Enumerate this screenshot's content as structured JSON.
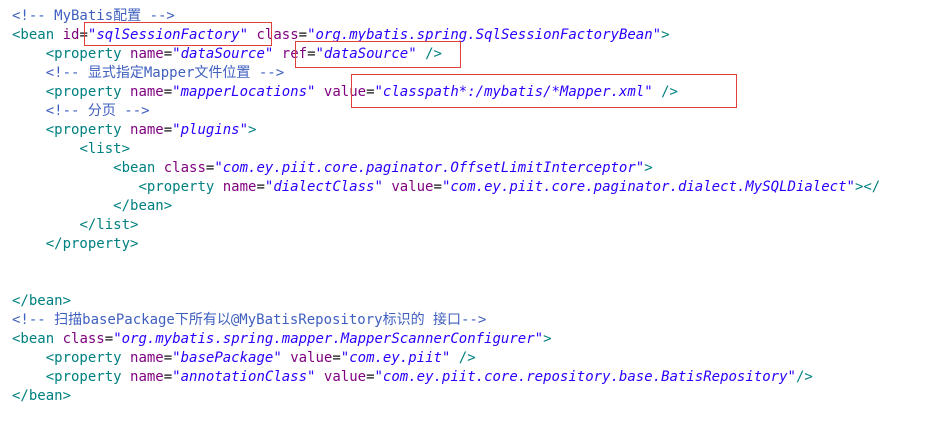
{
  "editor": {
    "highlight_color": "#e0403a",
    "lines": [
      {
        "tokens": [
          {
            "t": "comment",
            "v": "<!-- MyBatis配置 -->"
          }
        ]
      },
      {
        "tokens": [
          {
            "t": "tag",
            "v": "<bean"
          },
          {
            "t": "space",
            "v": " "
          },
          {
            "t": "attr",
            "v": "id"
          },
          {
            "t": "eq",
            "v": "="
          },
          {
            "t": "val",
            "v": "\"sqlSessionFactory\""
          },
          {
            "t": "space",
            "v": " "
          },
          {
            "t": "attr",
            "v": "class"
          },
          {
            "t": "eq",
            "v": "="
          },
          {
            "t": "val",
            "v": "\"org.mybatis.spring.SqlSessionFactoryBean\""
          },
          {
            "t": "punct",
            "v": ">"
          }
        ]
      },
      {
        "tokens": [
          {
            "t": "space",
            "v": "    "
          },
          {
            "t": "tag",
            "v": "<property"
          },
          {
            "t": "space",
            "v": " "
          },
          {
            "t": "attr",
            "v": "name"
          },
          {
            "t": "eq",
            "v": "="
          },
          {
            "t": "val",
            "v": "\"dataSource\""
          },
          {
            "t": "space",
            "v": " "
          },
          {
            "t": "attr",
            "v": "ref"
          },
          {
            "t": "eq",
            "v": "="
          },
          {
            "t": "val",
            "v": "\"dataSource\""
          },
          {
            "t": "space",
            "v": " "
          },
          {
            "t": "punct",
            "v": "/>"
          }
        ]
      },
      {
        "tokens": [
          {
            "t": "space",
            "v": "    "
          },
          {
            "t": "comment",
            "v": "<!-- 显式指定Mapper文件位置 -->"
          }
        ]
      },
      {
        "tokens": [
          {
            "t": "space",
            "v": "    "
          },
          {
            "t": "tag",
            "v": "<property"
          },
          {
            "t": "space",
            "v": " "
          },
          {
            "t": "attr",
            "v": "name"
          },
          {
            "t": "eq",
            "v": "="
          },
          {
            "t": "val",
            "v": "\"mapperLocations\""
          },
          {
            "t": "space",
            "v": " "
          },
          {
            "t": "attr",
            "v": "value"
          },
          {
            "t": "eq",
            "v": "="
          },
          {
            "t": "val",
            "v": "\"classpath*:/mybatis/*Mapper.xml\""
          },
          {
            "t": "space",
            "v": " "
          },
          {
            "t": "punct",
            "v": "/>"
          }
        ]
      },
      {
        "tokens": [
          {
            "t": "space",
            "v": "    "
          },
          {
            "t": "comment",
            "v": "<!-- 分页 -->"
          }
        ]
      },
      {
        "tokens": [
          {
            "t": "space",
            "v": "    "
          },
          {
            "t": "tag",
            "v": "<property"
          },
          {
            "t": "space",
            "v": " "
          },
          {
            "t": "attr",
            "v": "name"
          },
          {
            "t": "eq",
            "v": "="
          },
          {
            "t": "val",
            "v": "\"plugins\""
          },
          {
            "t": "punct",
            "v": ">"
          }
        ]
      },
      {
        "tokens": [
          {
            "t": "space",
            "v": "        "
          },
          {
            "t": "tag",
            "v": "<list>"
          }
        ]
      },
      {
        "tokens": [
          {
            "t": "space",
            "v": "            "
          },
          {
            "t": "tag",
            "v": "<bean"
          },
          {
            "t": "space",
            "v": " "
          },
          {
            "t": "attr",
            "v": "class"
          },
          {
            "t": "eq",
            "v": "="
          },
          {
            "t": "val",
            "v": "\"com.ey.piit.core.paginator.OffsetLimitInterceptor\""
          },
          {
            "t": "punct",
            "v": ">"
          }
        ]
      },
      {
        "tokens": [
          {
            "t": "space",
            "v": "               "
          },
          {
            "t": "tag",
            "v": "<property"
          },
          {
            "t": "space",
            "v": " "
          },
          {
            "t": "attr",
            "v": "name"
          },
          {
            "t": "eq",
            "v": "="
          },
          {
            "t": "val",
            "v": "\"dialectClass\""
          },
          {
            "t": "space",
            "v": " "
          },
          {
            "t": "attr",
            "v": "value"
          },
          {
            "t": "eq",
            "v": "="
          },
          {
            "t": "val",
            "v": "\"com.ey.piit.core.paginator.dialect.MySQLDialect\""
          },
          {
            "t": "punct",
            "v": "></"
          }
        ]
      },
      {
        "tokens": [
          {
            "t": "space",
            "v": "            "
          },
          {
            "t": "tag",
            "v": "</bean>"
          }
        ]
      },
      {
        "tokens": [
          {
            "t": "space",
            "v": "        "
          },
          {
            "t": "tag",
            "v": "</list>"
          }
        ]
      },
      {
        "tokens": [
          {
            "t": "space",
            "v": "    "
          },
          {
            "t": "tag",
            "v": "</property>"
          }
        ]
      },
      {
        "tokens": []
      },
      {
        "tokens": []
      },
      {
        "tokens": [
          {
            "t": "tag",
            "v": "</bean>"
          }
        ]
      },
      {
        "tokens": [
          {
            "t": "comment",
            "v": "<!-- 扫描basePackage下所有以@MyBatisRepository标识的 接口-->"
          }
        ]
      },
      {
        "tokens": [
          {
            "t": "tag",
            "v": "<bean"
          },
          {
            "t": "space",
            "v": " "
          },
          {
            "t": "attr",
            "v": "class"
          },
          {
            "t": "eq",
            "v": "="
          },
          {
            "t": "val",
            "v": "\"org.mybatis.spring.mapper.MapperScannerConfigurer\""
          },
          {
            "t": "punct",
            "v": ">"
          }
        ]
      },
      {
        "tokens": [
          {
            "t": "space",
            "v": "    "
          },
          {
            "t": "tag",
            "v": "<property"
          },
          {
            "t": "space",
            "v": " "
          },
          {
            "t": "attr",
            "v": "name"
          },
          {
            "t": "eq",
            "v": "="
          },
          {
            "t": "val",
            "v": "\"basePackage\""
          },
          {
            "t": "space",
            "v": " "
          },
          {
            "t": "attr",
            "v": "value"
          },
          {
            "t": "eq",
            "v": "="
          },
          {
            "t": "val",
            "v": "\"com.ey.piit\""
          },
          {
            "t": "space",
            "v": " "
          },
          {
            "t": "punct",
            "v": "/>"
          }
        ]
      },
      {
        "tokens": [
          {
            "t": "space",
            "v": "    "
          },
          {
            "t": "tag",
            "v": "<property"
          },
          {
            "t": "space",
            "v": " "
          },
          {
            "t": "attr",
            "v": "name"
          },
          {
            "t": "eq",
            "v": "="
          },
          {
            "t": "val",
            "v": "\"annotationClass\""
          },
          {
            "t": "space",
            "v": " "
          },
          {
            "t": "attr",
            "v": "value"
          },
          {
            "t": "eq",
            "v": "="
          },
          {
            "t": "val",
            "v": "\"com.ey.piit.core.repository.base.BatisRepository\""
          },
          {
            "t": "punct",
            "v": "/>"
          }
        ]
      },
      {
        "tokens": [
          {
            "t": "tag",
            "v": "</bean>"
          }
        ]
      }
    ]
  }
}
